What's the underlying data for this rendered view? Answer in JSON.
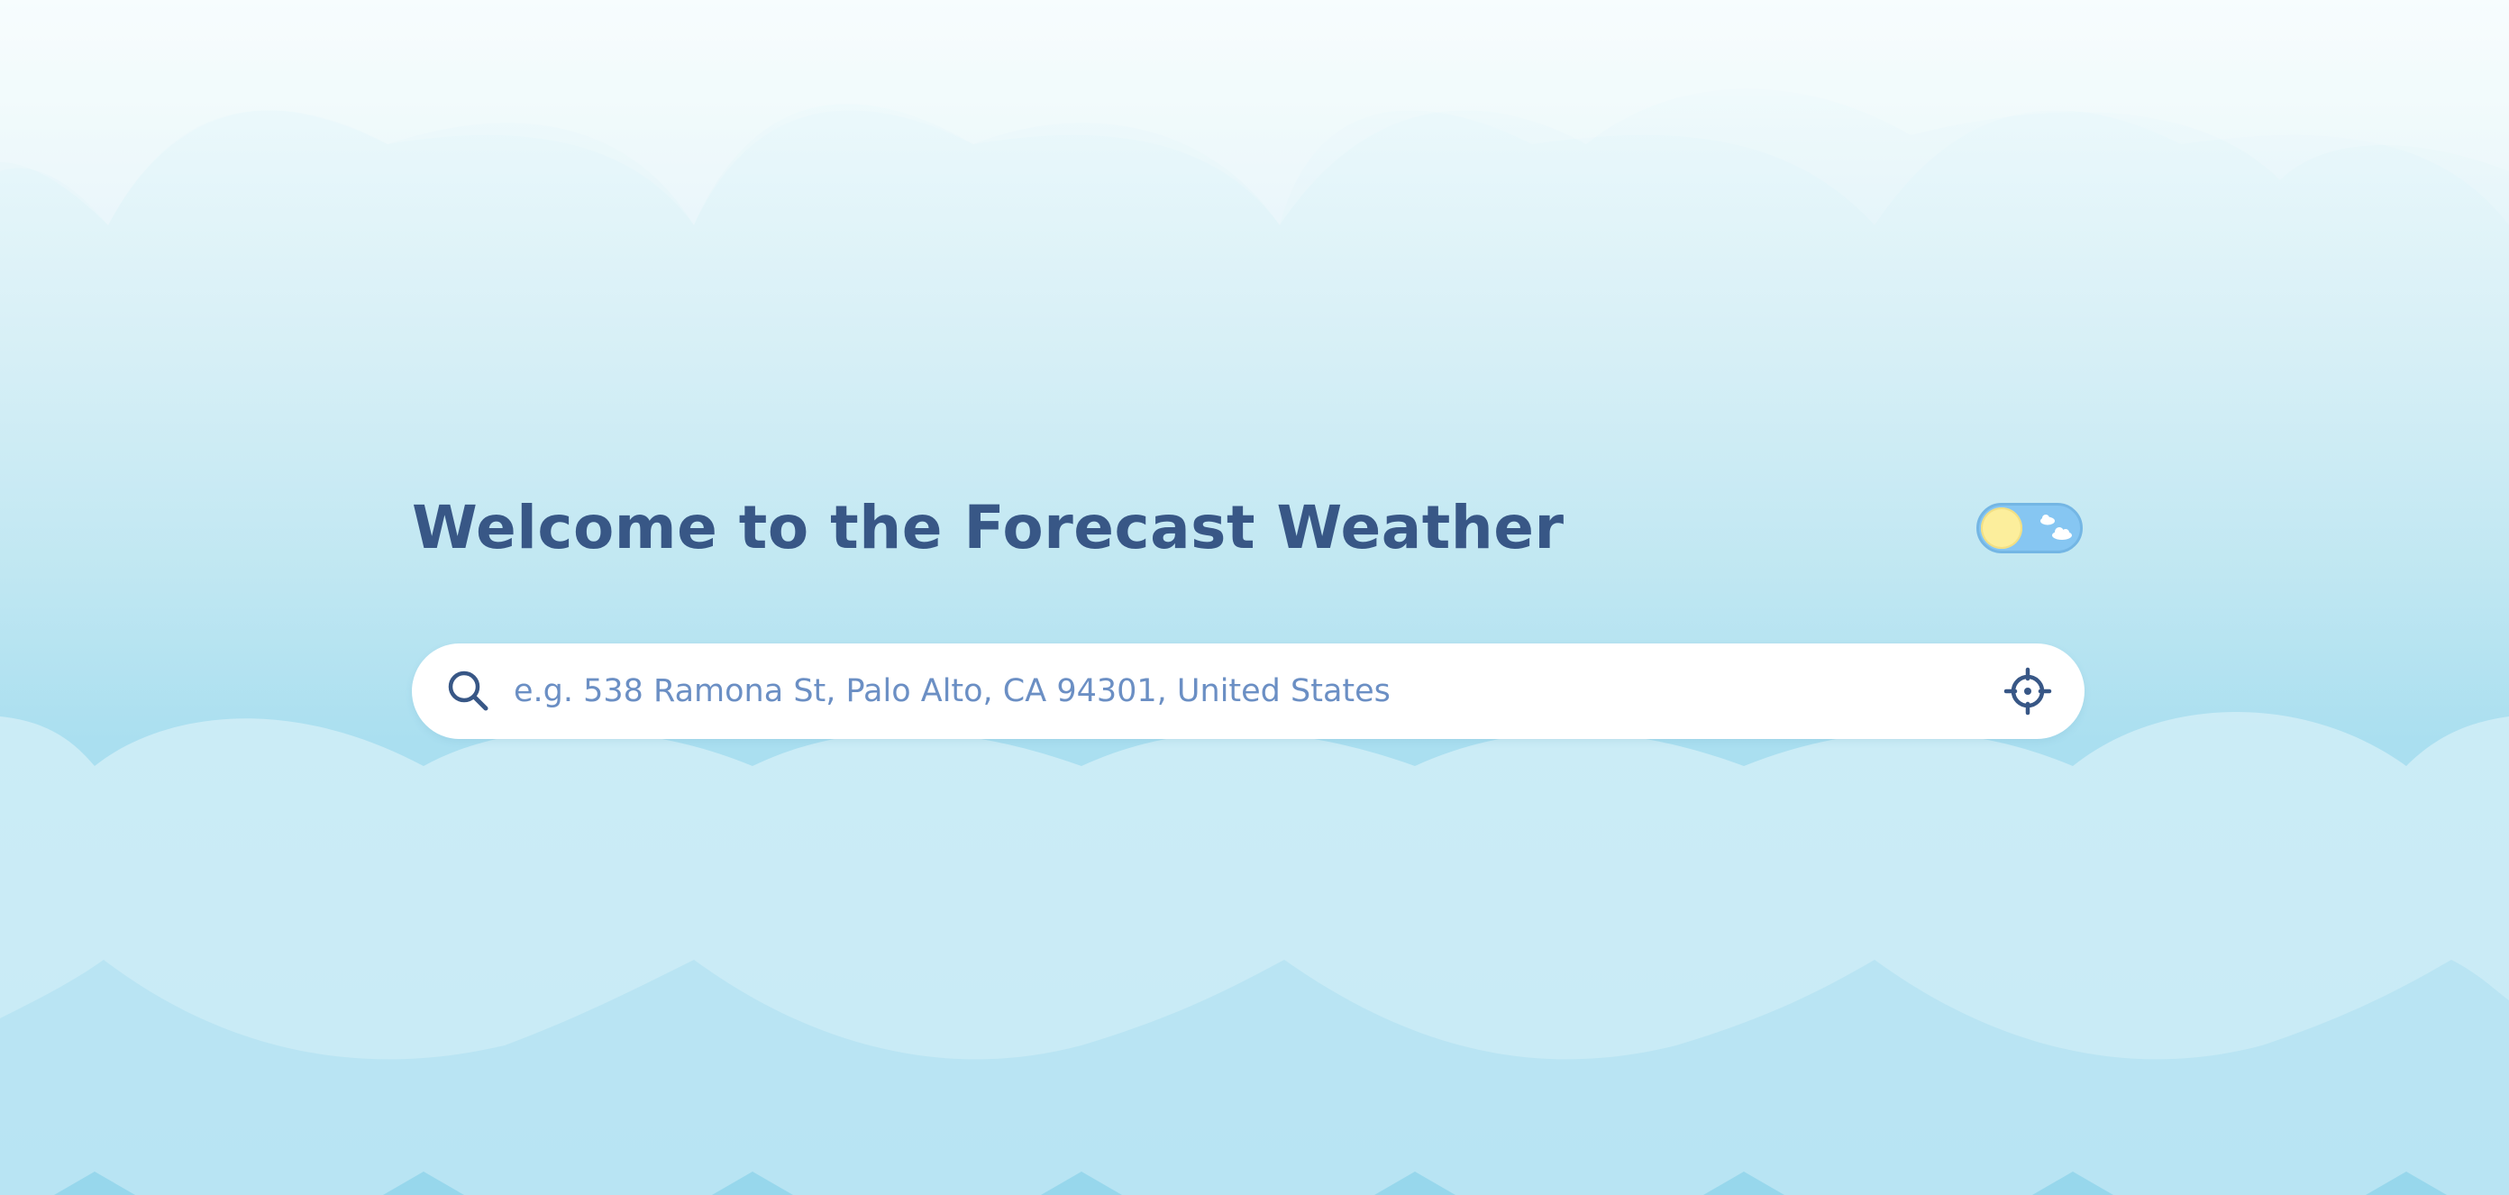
{
  "page": {
    "title": "Welcome to the Forecast Weather"
  },
  "theme_toggle": {
    "state": "light",
    "knob_icon": "sun-icon",
    "track_icon": "cloud-icon"
  },
  "search": {
    "placeholder": "e.g. 538 Ramona St, Palo Alto, CA 94301, United States",
    "value": "",
    "icon": "search-icon",
    "locate_icon": "crosshair-icon"
  },
  "colors": {
    "title": "#385786",
    "placeholder": "#6b8fc4",
    "toggle_track": "#86c6f2",
    "sun": "#fcee9c",
    "search_bg": "#ffffff"
  }
}
